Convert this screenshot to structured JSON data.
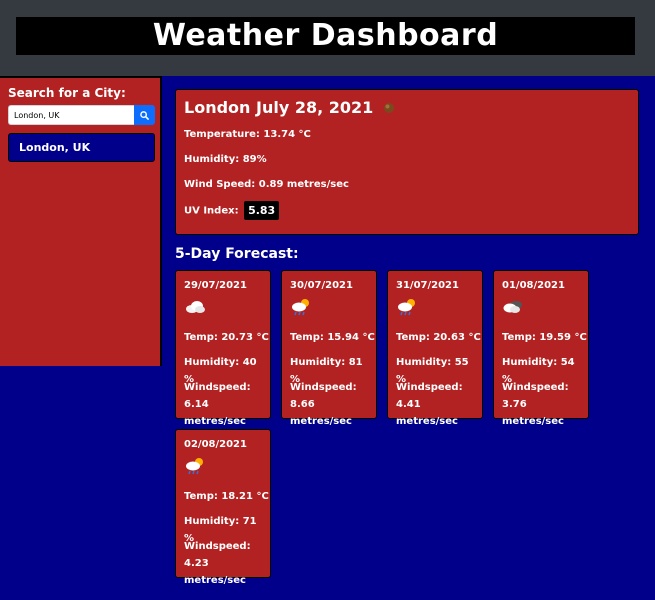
{
  "header": {
    "title": "Weather Dashboard"
  },
  "sidebar": {
    "search_label": "Search for a City:",
    "search_value": "London, UK",
    "search_button_icon": "search-icon",
    "history": [
      {
        "label": "London, UK"
      }
    ]
  },
  "current": {
    "title": "London July 28, 2021",
    "icon": "rain-icon",
    "temperature": "Temperature: 13.74 °C",
    "humidity": "Humidity: 89%",
    "wind": "Wind Speed: 0.89 metres/sec",
    "uv_label": "UV Index:",
    "uv_value": "5.83"
  },
  "forecast": {
    "heading": "5-Day Forecast:",
    "days": [
      {
        "date": "29/07/2021",
        "icon": "cloud-icon",
        "temp": "Temp: 20.73 °C",
        "humidity": "Humidity: 40 %",
        "wind": "Windspeed: 6.14 metres/sec"
      },
      {
        "date": "30/07/2021",
        "icon": "sun-rain-cloud-icon",
        "temp": "Temp: 15.94 °C",
        "humidity": "Humidity: 81 %",
        "wind": "Windspeed: 8.66 metres/sec"
      },
      {
        "date": "31/07/2021",
        "icon": "sun-rain-cloud-icon",
        "temp": "Temp: 20.63 °C",
        "humidity": "Humidity: 55 %",
        "wind": "Windspeed: 4.41 metres/sec"
      },
      {
        "date": "01/08/2021",
        "icon": "broken-clouds-icon",
        "temp": "Temp: 19.59 °C",
        "humidity": "Humidity: 54 %",
        "wind": "Windspeed: 3.76 metres/sec"
      },
      {
        "date": "02/08/2021",
        "icon": "sun-rain-cloud-icon",
        "temp": "Temp: 18.21 °C",
        "humidity": "Humidity: 71 %",
        "wind": "Windspeed: 4.23 metres/sec"
      }
    ]
  },
  "colors": {
    "background": "#00008b",
    "header": "#343a40",
    "card": "#b22222",
    "search_button": "#0d6efd"
  }
}
